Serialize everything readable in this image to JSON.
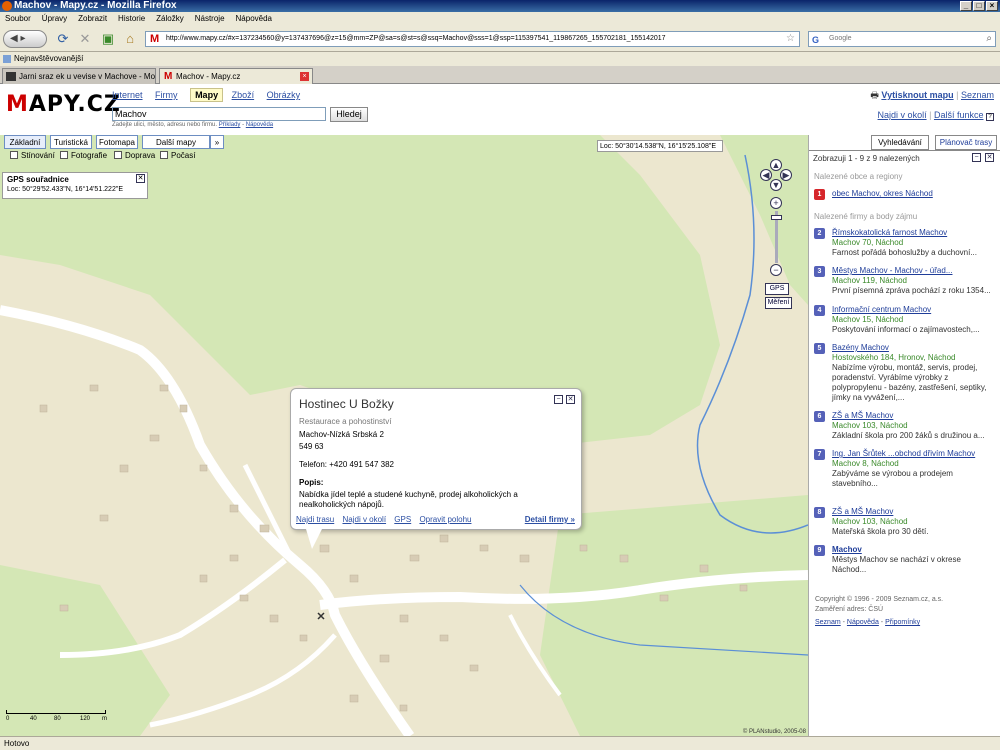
{
  "window": {
    "title": "Machov - Mapy.cz - Mozilla Firefox"
  },
  "menu": [
    "Soubor",
    "Úpravy",
    "Zobrazit",
    "Historie",
    "Záložky",
    "Nástroje",
    "Nápověda"
  ],
  "nav": {
    "url": "http://www.mapy.cz/#x=137234560@y=137437696@z=15@mm=ZP@sa=s@st=s@ssq=Machov@sss=1@ssp=115397541_119867265_155702181_155142017",
    "search_placeholder": "Google"
  },
  "bookmarks": {
    "item": "Nejnavštěvovanější"
  },
  "tabs": [
    {
      "label": "Jarni sraz ek u vevise v Machove - Moto..."
    },
    {
      "label": "Machov - Mapy.cz"
    }
  ],
  "site": {
    "logo_m": "M",
    "logo_rest": "APY.CZ",
    "services": [
      "Internet",
      "Firmy",
      "Mapy",
      "Zboží",
      "Obrázky"
    ],
    "query": "Machov",
    "search_button": "Hledej",
    "hint": "Zadejte ulici, město, adresu nebo firmu.",
    "hint_link1": "Příklady",
    "hint_sep": " - ",
    "hint_link2": "Nápověda",
    "print": "Vytisknout mapu",
    "seznam": "Seznam",
    "nearby": "Najdi v okolí",
    "more": "Další funkce"
  },
  "map": {
    "tabs": [
      "Základní",
      "Turistická",
      "Fotomapa",
      "Další mapy"
    ],
    "layers": [
      "Stínování",
      "Fotografie",
      "Doprava",
      "Počasí"
    ],
    "gps_title": "GPS souřadnice",
    "gps_loc": "Loc: 50°29'52.433\"N, 16°14'51.222\"E",
    "cursor_loc": "Loc: 50°30'14.538\"N, 16°15'25.108\"E",
    "gps_btn": "GPS",
    "measure_btn": "Měření",
    "scale": [
      "0",
      "40",
      "80",
      "120",
      "m"
    ],
    "copyright": "© PLANstudio, 2005-08"
  },
  "popup": {
    "title": "Hostinec U Božky",
    "category": "Restaurace a pohostinství",
    "addr1": "Machov-Nízká Srbská 2",
    "addr2": "549 63",
    "phone": "Telefon: +420 491 547 382",
    "desc_label": "Popis:",
    "desc": "Nabídka jídel teplé a studené kuchyně, prodej alkoholických a nealkoholických nápojů.",
    "links": [
      "Najdi trasu",
      "Najdi v okolí",
      "GPS",
      "Opravit polohu"
    ],
    "detail": "Detail firmy »"
  },
  "panel": {
    "tab_search": "Vyhledávání",
    "tab_route": "Plánovač trasy",
    "head": "Zobrazuji 1 - 9 z 9 nalezených",
    "sec_places": "Nalezené obce a regiony",
    "sec_firms": "Nalezené firmy a body zájmu",
    "items": [
      {
        "n": "1",
        "name": "obec Machov, okres Náchod",
        "addr": "",
        "desc": ""
      },
      {
        "n": "2",
        "name": "Římskokatolická farnost Machov",
        "addr": "Machov 70, Náchod",
        "desc": "Farnost pořádá bohoslužby a duchovní..."
      },
      {
        "n": "3",
        "name": "Městys Machov - Machov - úřad...",
        "addr": "Machov 119, Náchod",
        "desc": "První písemná zpráva pochází z roku 1354..."
      },
      {
        "n": "4",
        "name": "Informační centrum Machov",
        "addr": "Machov 15, Náchod",
        "desc": "Poskytování informací o zajímavostech,..."
      },
      {
        "n": "5",
        "name": "Bazény Machov",
        "addr": "Hostovského 184, Hronov, Náchod",
        "desc": "Nabízíme výrobu, montáž, servis, prodej, poradenství. Vyrábíme výrobky z polypropylenu - bazény, zastřešení, septiky, jímky na vyvážení,..."
      },
      {
        "n": "6",
        "name": "ZŠ a MŠ Machov",
        "addr": "Machov 103, Náchod",
        "desc": "Základní škola pro 200 žáků s družinou a..."
      },
      {
        "n": "7",
        "name": "Ing. Jan Šrůtek ...obchod dřivím Machov",
        "addr": "Machov 8, Náchod",
        "desc": "Zabýváme se výrobou a prodejem stavebního..."
      },
      {
        "n": "8",
        "name": "ZŠ a MŠ Machov",
        "addr": "Machov 103, Náchod",
        "desc": "Mateřská škola pro 30 dětí."
      },
      {
        "n": "9",
        "name": "Machov",
        "addr": "",
        "desc": "Městys Machov se nachází v okrese Náchod..."
      }
    ],
    "foot1": "Copyright © 1996 - 2009 Seznam.cz, a.s.",
    "foot2": "Zaměření adres: ČSÚ",
    "foot_links": [
      "Seznam",
      "Nápověda",
      "Připomínky"
    ]
  },
  "status": "Hotovo",
  "colors": {
    "map_bg": "#ece7cf",
    "forest": "#d4e7b5",
    "road": "#ffffff",
    "river": "#5b8fd6",
    "num_red": "#d6262b",
    "num_blue": "#5561b8",
    "link": "#1f3d99",
    "addr": "#3a8a2a"
  }
}
